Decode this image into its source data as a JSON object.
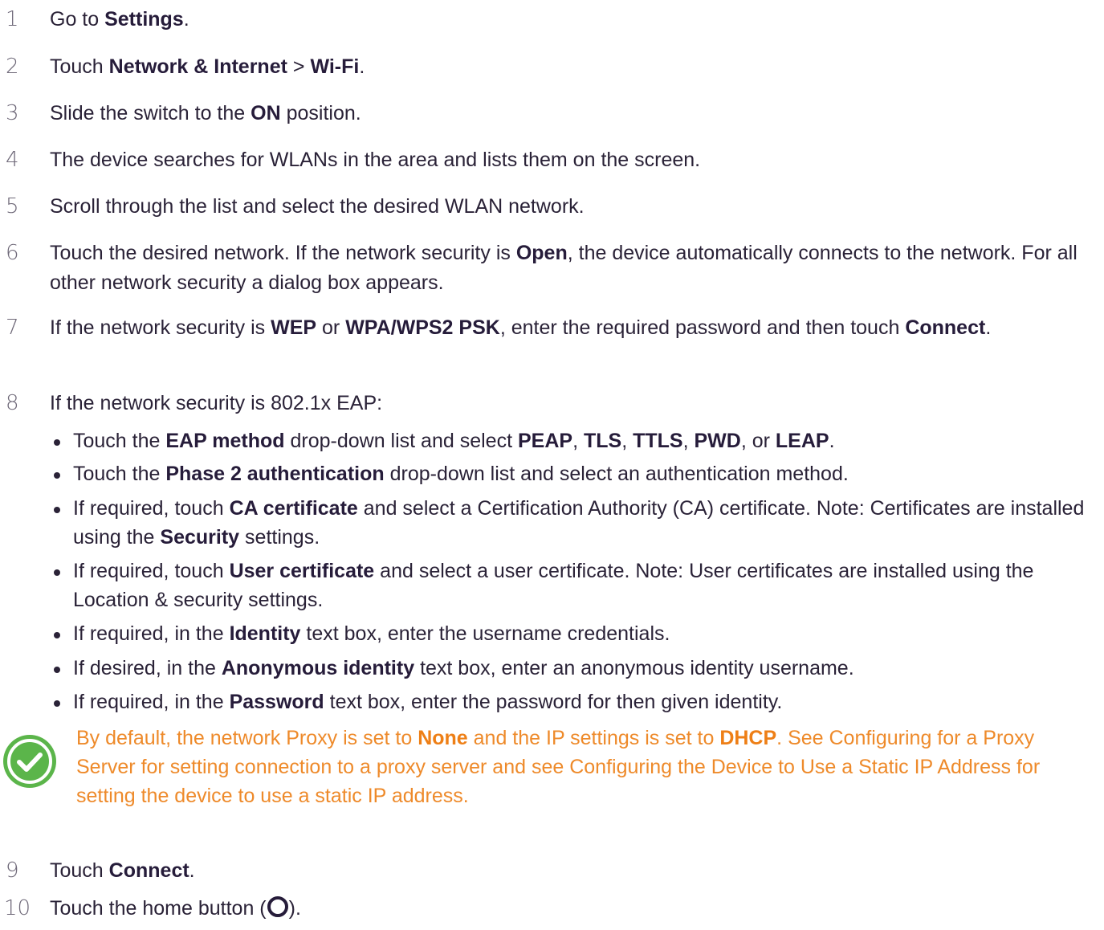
{
  "steps": [
    {
      "num": "1",
      "parts": [
        "Go to ",
        "Settings",
        "."
      ]
    },
    {
      "num": "2",
      "parts": [
        "Touch ",
        "Network & Internet",
        " > ",
        "Wi-Fi",
        "."
      ]
    },
    {
      "num": "3",
      "parts": [
        "Slide the switch to the ",
        "ON",
        " position."
      ]
    },
    {
      "num": "4",
      "text": "The device searches for WLANs in the area and lists them on the screen."
    },
    {
      "num": "5",
      "text": "Scroll through the list and select the desired WLAN network."
    },
    {
      "num": "6",
      "parts": [
        "Touch the desired network. If the network security is ",
        "Open",
        ", the device automatically connects to the network. For all other network security a dialog box appears."
      ]
    },
    {
      "num": "7",
      "parts": [
        "If the network security is ",
        "WEP",
        " or ",
        "WPA/WPS2 PSK",
        ", enter the required password and then touch ",
        "Connect",
        "."
      ]
    },
    {
      "num": "8",
      "text": "If the network security is 802.1x EAP:"
    },
    {
      "num": "9",
      "parts": [
        "Touch ",
        "Connect",
        "."
      ]
    },
    {
      "num": "10",
      "parts": [
        "Touch the home button (",
        ")."
      ]
    }
  ],
  "bullets": [
    {
      "parts": [
        "Touch the ",
        "EAP method",
        " drop-down list and select ",
        "PEAP",
        ", ",
        "TLS",
        ", ",
        "TTLS",
        ", ",
        "PWD",
        ", or ",
        "LEAP",
        "."
      ]
    },
    {
      "parts": [
        "Touch the ",
        "Phase 2 authentication",
        " drop-down list and select an authentication method."
      ]
    },
    {
      "parts": [
        "If required, touch ",
        "CA certificate",
        " and select a Certification Authority (CA) certificate. Note: Certificates are installed using the ",
        "Security",
        " settings."
      ]
    },
    {
      "parts": [
        "If required, touch ",
        "User certificate",
        " and select a user certificate. Note: User certificates are installed using the Location & security settings."
      ]
    },
    {
      "parts": [
        "If required, in the ",
        "Identity",
        " text box, enter the username credentials."
      ]
    },
    {
      "parts": [
        "If desired, in the ",
        "Anonymous identity",
        " text box, enter an anonymous identity username."
      ]
    },
    {
      "parts": [
        "If required, in the ",
        "Password",
        " text box, enter the password for then given identity."
      ]
    }
  ],
  "note": {
    "parts": [
      "By default, the network Proxy is set to ",
      "None",
      " and the IP settings is set to ",
      "DHCP",
      ". See Configuring for a Proxy Server for setting connection to a proxy server and see Configuring the Device to Use a Static IP Address for setting the device to use a static IP address."
    ],
    "icon": "check-circle-icon",
    "icon_color": "#5bb54a",
    "text_color": "#ee8a2a"
  },
  "colors": {
    "text": "#2a2237",
    "number": "#6e6878"
  }
}
